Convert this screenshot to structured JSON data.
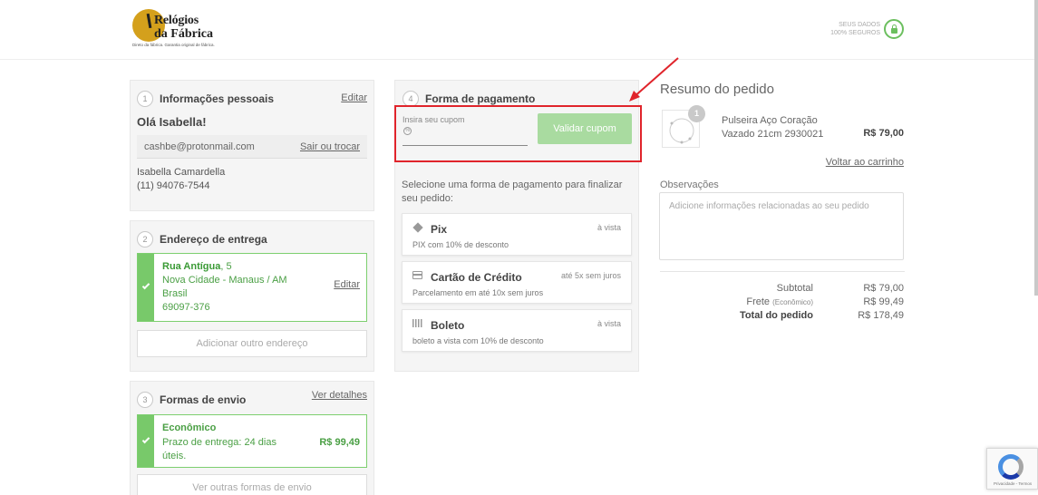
{
  "header": {
    "logo_line1": "Relógios",
    "logo_line2": "da Fábrica",
    "logo_tagline": "Direto da fábrica. Garantia original de fábrica.",
    "secure_line1": "SEUS DADOS",
    "secure_line2": "100% SEGUROS"
  },
  "personal": {
    "step": "1",
    "title": "Informações pessoais",
    "edit_label": "Editar",
    "greeting": "Olá Isabella!",
    "email": "cashbe@protonmail.com",
    "switch_label": "Sair ou trocar",
    "name": "Isabella Camardella",
    "phone": "(11) 94076-7544"
  },
  "delivery": {
    "step": "2",
    "title": "Endereço de entrega",
    "street": "Rua Antígua",
    "number": ", 5",
    "district_city": "Nova Cidade - Manaus / AM",
    "country": "Brasil",
    "zip": "69097-376",
    "edit_label": "Editar",
    "add_label": "Adicionar outro endereço"
  },
  "shipping": {
    "step": "3",
    "title": "Formas de envio",
    "details_label": "Ver detalhes",
    "method": "Econômico",
    "eta_line1": "Prazo de entrega: 24 dias",
    "eta_line2": "úteis.",
    "price": "R$ 99,49",
    "other_label": "Ver outras formas de envio"
  },
  "payment": {
    "step": "4",
    "title": "Forma de pagamento",
    "coupon_label": "Insira seu cupom",
    "coupon_value": "",
    "validate_label": "Validar cupom",
    "intro": "Selecione uma forma de pagamento para finalizar seu pedido:",
    "options": [
      {
        "name": "Pix",
        "right": "à vista",
        "desc": "PIX com 10% de desconto",
        "icon": "pix-icon"
      },
      {
        "name": "Cartão de Crédito",
        "right": "até 5x sem juros",
        "desc": "Parcelamento em até 10x sem juros",
        "icon": "credit-card-icon"
      },
      {
        "name": "Boleto",
        "right": "à vista",
        "desc": "boleto a vista com 10% de desconto",
        "icon": "barcode-icon"
      }
    ]
  },
  "summary": {
    "title": "Resumo do pedido",
    "qty": "1",
    "product_name": "Pulseira Aço Coração Vazado 21cm 2930021",
    "product_price": "R$ 79,00",
    "back_label": "Voltar ao carrinho",
    "obs_label": "Observações",
    "obs_placeholder": "Adicione informações relacionadas ao seu pedido",
    "subtotal_label": "Subtotal",
    "subtotal_value": "R$ 79,00",
    "freight_label": "Frete",
    "freight_note": "(Econômico)",
    "freight_value": "R$ 99,49",
    "total_label": "Total do pedido",
    "total_value": "R$ 178,49"
  },
  "recaptcha": {
    "footer": "Privacidade - Termos"
  },
  "colors": {
    "accent_green": "#78c96a",
    "highlight_red": "#e0242b",
    "logo_gold": "#d4a01c"
  }
}
